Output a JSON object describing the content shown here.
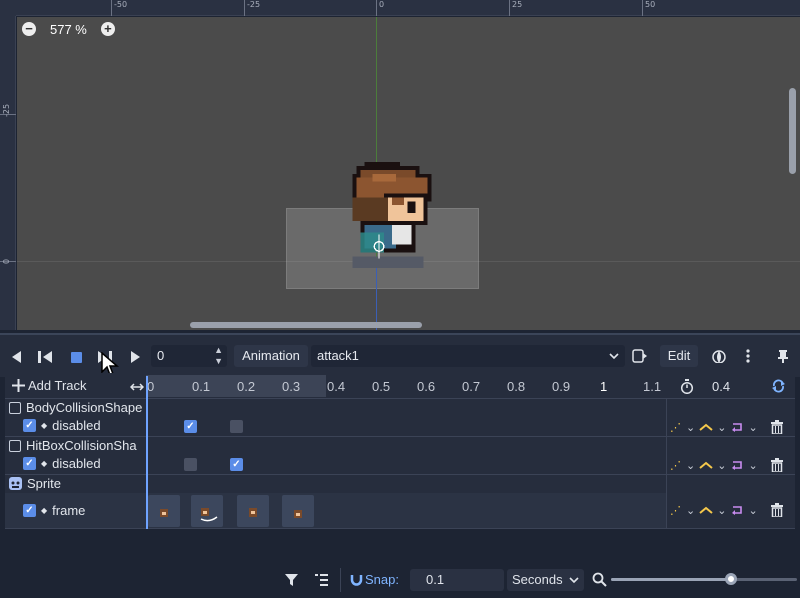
{
  "viewport": {
    "zoom_label": "577 %",
    "ruler_top_labels": [
      "-50",
      "-25",
      "0",
      "25",
      "50"
    ],
    "ruler_left_labels": [
      "-25",
      "0"
    ]
  },
  "toolbar": {
    "frame_value": "0",
    "animation_label": "Animation",
    "animation_name": "attack1",
    "edit_label": "Edit"
  },
  "timeline": {
    "add_track_label": "Add Track",
    "ticks": [
      "0",
      "0.1",
      "0.2",
      "0.3",
      "0.4",
      "0.5",
      "0.6",
      "0.7",
      "0.8",
      "0.9",
      "1",
      "1.1"
    ],
    "length_value": "0.4",
    "tracks": [
      {
        "node": "BodyCollisionShape",
        "property": "disabled"
      },
      {
        "node": "HitBoxCollisionSha",
        "property": "disabled"
      },
      {
        "node": "Sprite",
        "property": "frame"
      }
    ]
  },
  "bottom": {
    "snap_label": "Snap:",
    "snap_value": "0.1",
    "unit_label": "Seconds"
  },
  "colors": {
    "accent": "#5b8de8",
    "playhead": "#6fa3ff",
    "interp": "#f5c84b",
    "loop": "#c88cf0"
  }
}
